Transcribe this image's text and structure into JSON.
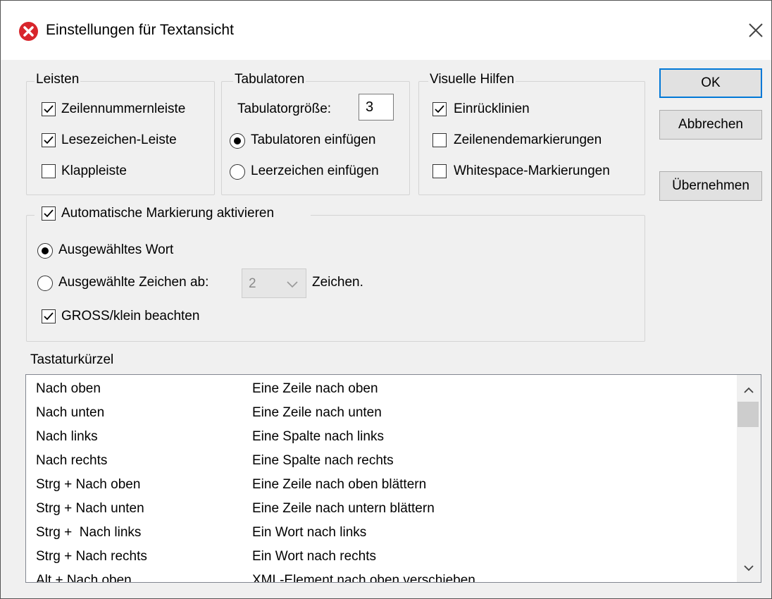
{
  "window": {
    "title": "Einstellungen für Textansicht"
  },
  "buttons": {
    "ok": "OK",
    "cancel": "Abbrechen",
    "apply": "Übernehmen"
  },
  "leisten": {
    "label": "Leisten",
    "items": [
      {
        "label": "Zeilennummernleiste",
        "checked": true
      },
      {
        "label": "Lesezeichen-Leiste",
        "checked": true
      },
      {
        "label": "Klappleiste",
        "checked": false
      }
    ]
  },
  "tabs": {
    "label": "Tabulatoren",
    "size_label": "Tabulatorgröße:",
    "size_value": "3",
    "options": [
      {
        "label": "Tabulatoren einfügen",
        "selected": true
      },
      {
        "label": "Leerzeichen einfügen",
        "selected": false
      }
    ]
  },
  "visual": {
    "label": "Visuelle Hilfen",
    "items": [
      {
        "label": "Einrücklinien",
        "checked": true
      },
      {
        "label": "Zeilenendemarkierungen",
        "checked": false
      },
      {
        "label": "Whitespace-Markierungen",
        "checked": false
      }
    ]
  },
  "highlight": {
    "label": "Automatische Markierung aktivieren",
    "checked": true,
    "option_word": "Ausgewähltes Wort",
    "option_chars": "Ausgewählte Zeichen ab:",
    "chars_value": "2",
    "chars_suffix": "Zeichen.",
    "case_label": "GROSS/klein beachten",
    "case_checked": true
  },
  "shortcuts": {
    "label": "Tastaturkürzel",
    "rows": [
      {
        "key": "Nach oben",
        "action": "Eine Zeile nach oben"
      },
      {
        "key": "Nach unten",
        "action": "Eine Zeile nach unten"
      },
      {
        "key": "Nach links",
        "action": "Eine Spalte nach links"
      },
      {
        "key": "Nach rechts",
        "action": "Eine Spalte nach rechts"
      },
      {
        "key": "Strg + Nach oben",
        "action": "Eine Zeile nach oben blättern"
      },
      {
        "key": "Strg + Nach unten",
        "action": "Eine Zeile nach untern blättern"
      },
      {
        "key": "Strg +  Nach links",
        "action": "Ein Wort nach links"
      },
      {
        "key": "Strg + Nach rechts",
        "action": "Ein Wort nach rechts"
      },
      {
        "key": "Alt + Nach oben",
        "action": "XML-Element nach oben verschieben"
      }
    ]
  }
}
